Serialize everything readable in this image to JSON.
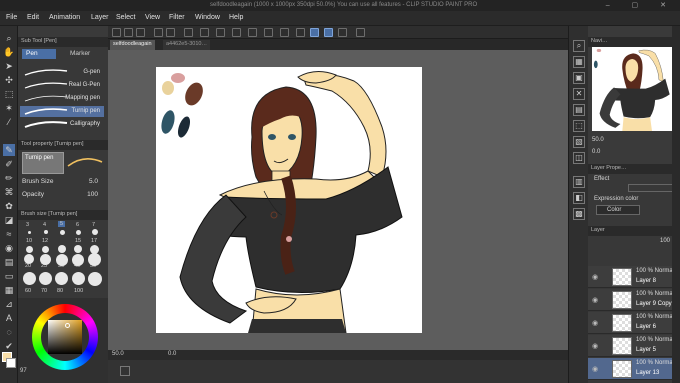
{
  "window": {
    "title": "selfdoodleagain (1000 x 1000px 350dpi 50.0%)  You can use all features - CLIP STUDIO PAINT PRO",
    "controls": [
      "–",
      "▢",
      "✕"
    ]
  },
  "menu": [
    "File",
    "Edit",
    "Animation",
    "Layer",
    "Select",
    "View",
    "Filter",
    "Window",
    "Help"
  ],
  "tabs": [
    {
      "label": "selfdoodleagain"
    },
    {
      "label": "a4462e5-3010…"
    }
  ],
  "subtool": {
    "header": "Sub Tool [Pen]",
    "tabs": [
      "Pen",
      "Marker"
    ],
    "brushes": [
      "G-pen",
      "Real G-Pen",
      "Mapping pen",
      "Turnip pen",
      "Calligraphy"
    ],
    "selected_index": 3
  },
  "tool_property": {
    "header": "Tool property [Turnip pen]",
    "current": "Turnip pen",
    "brush_size_label": "Brush Size",
    "brush_size_value": "5.0",
    "opacity_label": "Opacity",
    "opacity_value": "100"
  },
  "brush_size_panel": {
    "header": "Brush size [Turnip pen]",
    "row1": [
      "3",
      "4",
      "5",
      "6",
      "7"
    ],
    "row2": [
      "10",
      "12",
      "15",
      "17"
    ],
    "row3": [
      "20",
      "25",
      "30",
      "40",
      "50"
    ],
    "row4": [
      "60",
      "70",
      "80",
      "100"
    ],
    "selected": "5"
  },
  "canvas_status": {
    "zoom": "50.0",
    "angle": "0.0",
    "bottom_right": "97"
  },
  "navigator": {
    "header": "Navi…",
    "zoom": "50.0",
    "angle": "0.0"
  },
  "layer_property": {
    "header": "Layer Prope…",
    "effect_label": "Effect",
    "expression_label": "Expression color",
    "expression_value": "Color"
  },
  "layer_panel": {
    "header": "Layer",
    "opacity": "100",
    "layers": [
      {
        "mode": "100 % Normal",
        "name": "Layer 8"
      },
      {
        "mode": "100 % Normal",
        "name": "Layer 9 Copy"
      },
      {
        "mode": "100 % Normal",
        "name": "Layer 6"
      },
      {
        "mode": "100 % Normal",
        "name": "Layer 5"
      },
      {
        "mode": "100 % Normal",
        "name": "Layer 13"
      }
    ],
    "selected_index": 4
  },
  "colors": {
    "accent": "#4a6fa5",
    "hair": "#5a2a1c",
    "skin": "#f9dfa8",
    "shirt": "#2e2e2e",
    "palette": [
      "#d99f9e",
      "#e9d29c",
      "#6a3a28",
      "#2f5566",
      "#1c2a36",
      "#111111"
    ]
  }
}
